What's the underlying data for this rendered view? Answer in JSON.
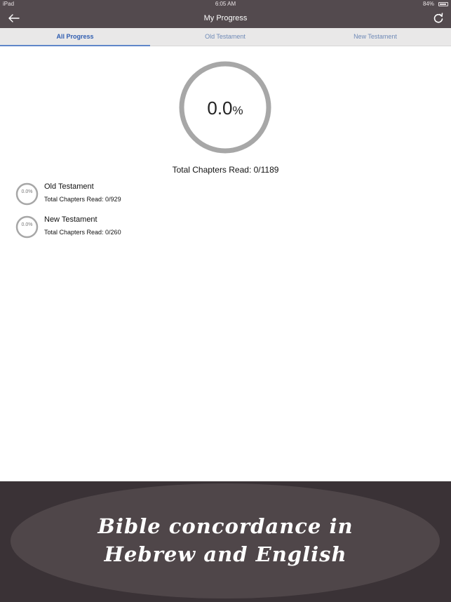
{
  "status_bar": {
    "device": "iPad",
    "time": "6:05 AM",
    "battery": "84%"
  },
  "nav": {
    "title": "My Progress",
    "back_icon": "arrow-left-icon",
    "refresh_icon": "refresh-icon"
  },
  "tabs": [
    {
      "label": "All Progress",
      "active": true
    },
    {
      "label": "Old Testament",
      "active": false
    },
    {
      "label": "New Testament",
      "active": false
    }
  ],
  "overall": {
    "percent_value": "0.0",
    "percent_symbol": "%",
    "progress_fraction": 0.0,
    "total_text": "Total Chapters Read: 0/1189"
  },
  "sections": [
    {
      "percent": "0.0%",
      "name": "Old Testament",
      "total_text": "Total Chapters Read: 0/929",
      "progress_fraction": 0.0
    },
    {
      "percent": "0.0%",
      "name": "New Testament",
      "total_text": "Total Chapters Read: 0/260",
      "progress_fraction": 0.0
    }
  ],
  "banner": {
    "line1": "Bible concordance in",
    "line2": "Hebrew and English"
  },
  "colors": {
    "header": "#534a4e",
    "ring": "#a7a7a7",
    "tab_active": "#2f5db0",
    "banner_bg": "#3a3236",
    "banner_ellipse": "#4f4649"
  }
}
